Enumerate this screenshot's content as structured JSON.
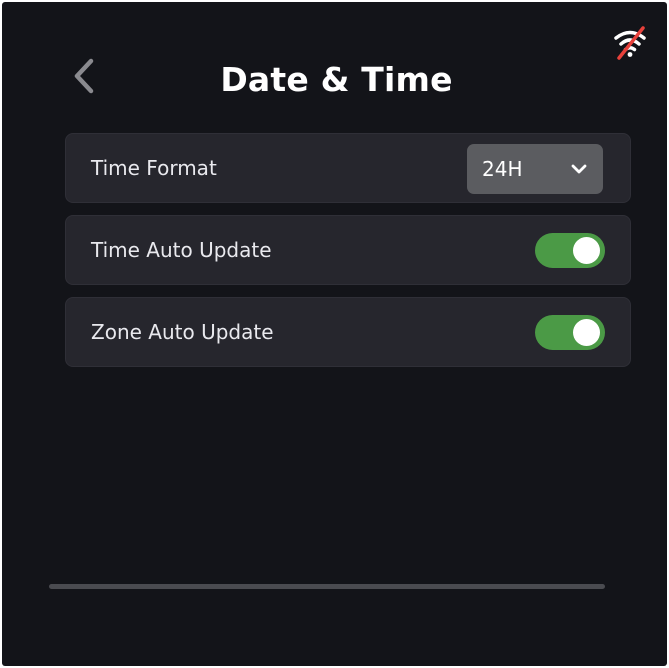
{
  "header": {
    "title": "Date & Time",
    "back_icon": "chevron-left-icon",
    "status_icon": "wifi-off-icon"
  },
  "settings": {
    "time_format": {
      "label": "Time Format",
      "value": "24H",
      "icon": "chevron-down-icon"
    },
    "time_auto_update": {
      "label": "Time Auto Update",
      "enabled": true
    },
    "zone_auto_update": {
      "label": "Zone Auto Update",
      "enabled": true
    }
  },
  "colors": {
    "background": "#131419",
    "card": "#26262d",
    "toggle_on": "#4b9a46",
    "dropdown": "#5b5c60",
    "wifi_off_slash": "#e8413b"
  }
}
